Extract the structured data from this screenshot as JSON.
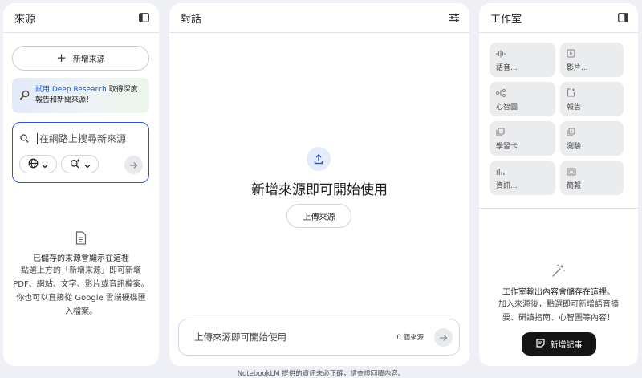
{
  "sources": {
    "title": "來源",
    "add_source_label": "新增來源",
    "promo": {
      "link_text": "試用 Deep Research",
      "text": " 取得深度報告和新聞來源！"
    },
    "search": {
      "placeholder": "在網路上搜尋新來源"
    },
    "empty_title": "已儲存的來源會顯示在這裡",
    "empty_description": "點選上方的「新增來源」即可新增 PDF、網站、文字、影片或音訊檔案。你也可以直接從 Google 雲端硬碟匯入檔案。"
  },
  "chat": {
    "title": "對話",
    "headline": "新增來源即可開始使用",
    "upload_label": "上傳來源",
    "input_placeholder": "上傳來源即可開始使用",
    "source_count": "0 個來源"
  },
  "studio": {
    "title": "工作室",
    "tiles": [
      {
        "label": "語音...",
        "icon": "audio-waveform-icon"
      },
      {
        "label": "影片...",
        "icon": "video-icon"
      },
      {
        "label": "心智圖",
        "icon": "mind-map-icon"
      },
      {
        "label": "報告",
        "icon": "report-icon"
      },
      {
        "label": "學習卡",
        "icon": "flashcards-icon"
      },
      {
        "label": "測驗",
        "icon": "quiz-icon"
      },
      {
        "label": "資訊...",
        "icon": "infographic-icon"
      },
      {
        "label": "簡報",
        "icon": "slides-icon"
      }
    ],
    "empty_title": "工作室輸出內容會儲存在這裡。",
    "empty_description": "加入來源後，點選即可新增語音摘要、研讀指南、心智圖等內容！",
    "add_note_label": "新增記事"
  },
  "footer": {
    "disclaimer": "NotebookLM 提供的資訊未必正確，請查證回覆內容。"
  },
  "colors": {
    "background": "#eef0f5",
    "accent_blue": "#2f54c8",
    "dark_button": "#151515"
  }
}
